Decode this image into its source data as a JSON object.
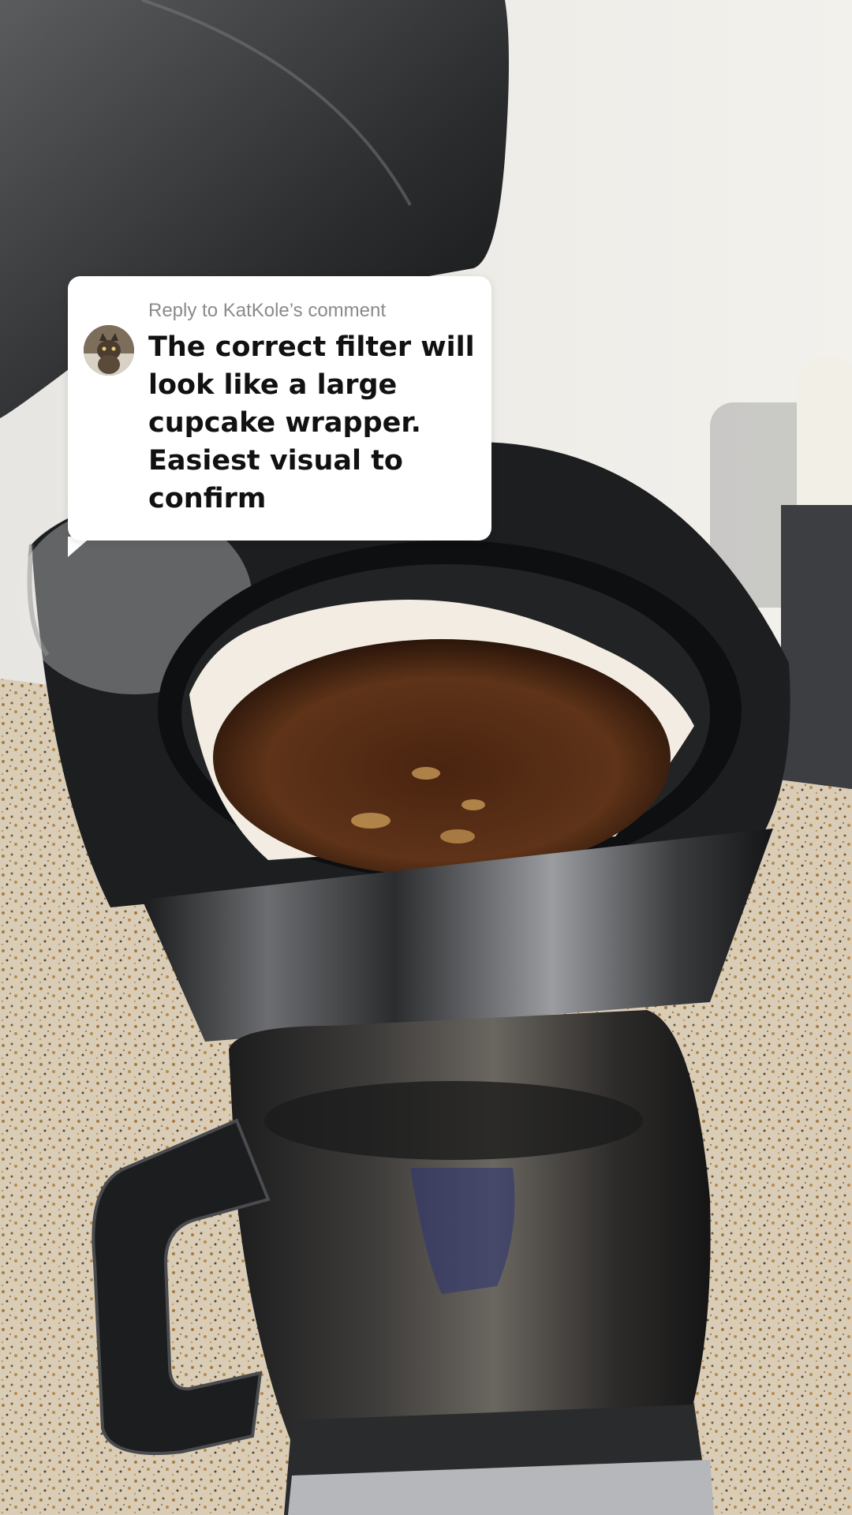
{
  "reply_bubble": {
    "reply_to_label": "Reply to KatKole’s comment",
    "comment_text": "The correct filter will look like a large cupcake wrapper. Easiest visual to confirm"
  },
  "icons": {
    "avatar": "cat-avatar",
    "background": "coffee-maker-photo"
  },
  "colors": {
    "bubble_bg": "#ffffff",
    "meta_text": "#8a8a8a",
    "comment_text": "#111111"
  }
}
